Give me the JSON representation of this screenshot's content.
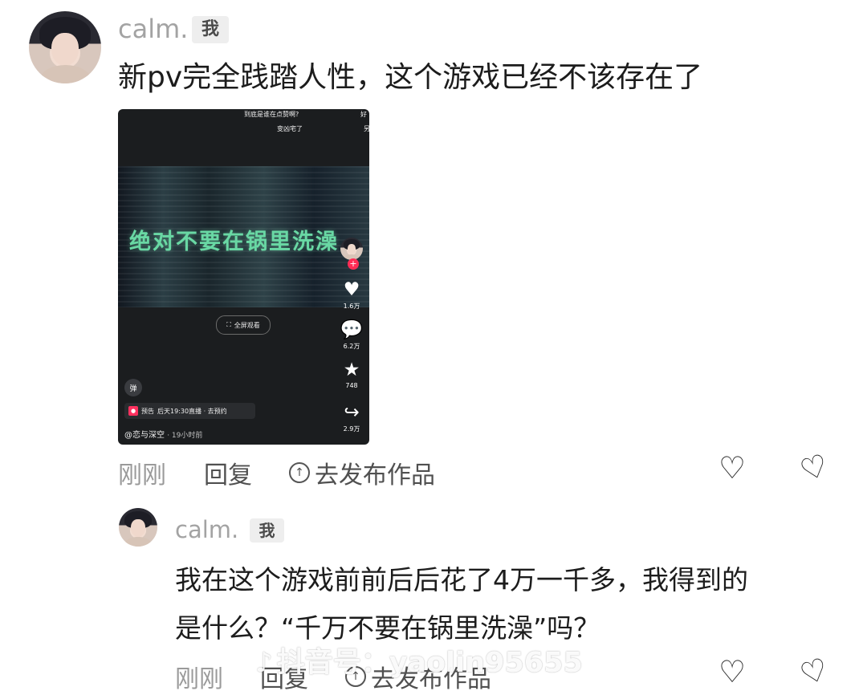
{
  "comment_1": {
    "username": "calm.",
    "me_tag": "我",
    "text": "新pv完全践踏人性，这个游戏已经不该存在了",
    "time": "刚刚",
    "reply": "回复",
    "publish": "去发布作品"
  },
  "video": {
    "top_comment_1": "到底是谁在点赞啊?",
    "top_comment_2": "变凶宅了",
    "side_comment_1": "好",
    "side_comment_2": "另",
    "title": "绝对不要在锅里洗澡",
    "fullscreen": "全屏观看",
    "likes": "1.6万",
    "comments": "6.2万",
    "favorites": "748",
    "shares": "2.9万",
    "bullet": "弹",
    "live_tag": "预告",
    "live_text": "后天19:30直播 · 去预约",
    "author": "@恋与深空",
    "author_time": "· 19小时前"
  },
  "comment_2": {
    "username": "calm.",
    "me_tag": "我",
    "text_line_1": "我在这个游戏前前后后花了4万一千多，我得到的",
    "text_line_2": "是什么？“千万不要在锅里洗澡”吗？",
    "time": "刚刚",
    "reply": "回复",
    "publish": "去发布作品"
  },
  "watermark": "抖音号：yaolin95655",
  "icons": {
    "heart": "heart-icon",
    "dislike": "broken-heart-icon",
    "publish": "up-arrow-circle-icon",
    "music": "music-note-icon"
  }
}
